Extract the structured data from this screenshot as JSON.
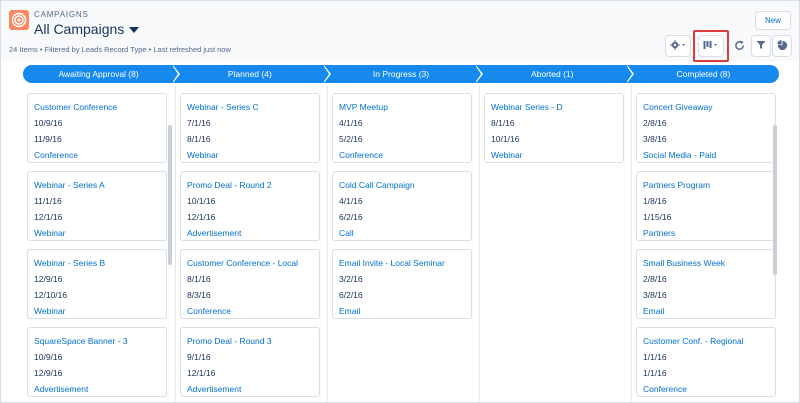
{
  "header": {
    "object_label": "CAMPAIGNS",
    "list_view_title": "All Campaigns",
    "subtitle": "24 Items • Filtered by Leads Record Type • Last refreshed just now",
    "new_button_label": "New",
    "icons": {
      "app": "target-icon",
      "settings": "gear-icon",
      "view_switcher": "kanban-view-icon",
      "refresh": "refresh-icon",
      "filter": "filter-icon",
      "chart": "pie-chart-icon"
    },
    "highlight_color": "#d93c3c"
  },
  "accent_color": "#1589ee",
  "stages": [
    {
      "label": "Awaiting Approval (8)",
      "cards": [
        {
          "name": "Customer Conference",
          "start": "10/9/16",
          "end": "11/9/16",
          "type": "Conference"
        },
        {
          "name": "Webinar - Series A",
          "start": "11/1/16",
          "end": "12/1/16",
          "type": "Webinar"
        },
        {
          "name": "Webinar - Series B",
          "start": "12/9/16",
          "end": "12/10/16",
          "type": "Webinar"
        },
        {
          "name": "SquareSpace Banner - 3",
          "start": "10/9/16",
          "end": "12/9/16",
          "type": "Advertisement"
        }
      ]
    },
    {
      "label": "Planned (4)",
      "cards": [
        {
          "name": "Webinar - Series C",
          "start": "7/1/16",
          "end": "8/1/16",
          "type": "Webinar"
        },
        {
          "name": "Promo Deal - Round 2",
          "start": "10/1/16",
          "end": "12/1/16",
          "type": "Advertisement"
        },
        {
          "name": "Customer Conference - Local",
          "start": "8/1/16",
          "end": "8/3/16",
          "type": "Conference"
        },
        {
          "name": "Promo Deal - Round 3",
          "start": "9/1/16",
          "end": "12/1/16",
          "type": "Advertisement"
        }
      ]
    },
    {
      "label": "In Progress (3)",
      "cards": [
        {
          "name": "MVP Meetup",
          "start": "4/1/16",
          "end": "5/2/16",
          "type": "Conference"
        },
        {
          "name": "Cold Call Campaign",
          "start": "4/1/16",
          "end": "6/2/16",
          "type": "Call"
        },
        {
          "name": "Email Invite - Local Seminar",
          "start": "3/2/16",
          "end": "6/2/16",
          "type": "Email"
        }
      ]
    },
    {
      "label": "Aborted (1)",
      "cards": [
        {
          "name": "Webinar Series - D",
          "start": "8/1/16",
          "end": "10/1/16",
          "type": "Webinar"
        }
      ]
    },
    {
      "label": "Completed (8)",
      "cards": [
        {
          "name": "Concert Giveaway",
          "start": "2/8/16",
          "end": "3/8/16",
          "type": "Social Media - Paid"
        },
        {
          "name": "Partners Program",
          "start": "1/8/16",
          "end": "1/15/16",
          "type": "Partners"
        },
        {
          "name": "Small Business Week",
          "start": "2/8/16",
          "end": "3/8/16",
          "type": "Email"
        },
        {
          "name": "Customer Conf. - Regional",
          "start": "1/1/16",
          "end": "1/1/16",
          "type": "Conference"
        }
      ]
    }
  ]
}
